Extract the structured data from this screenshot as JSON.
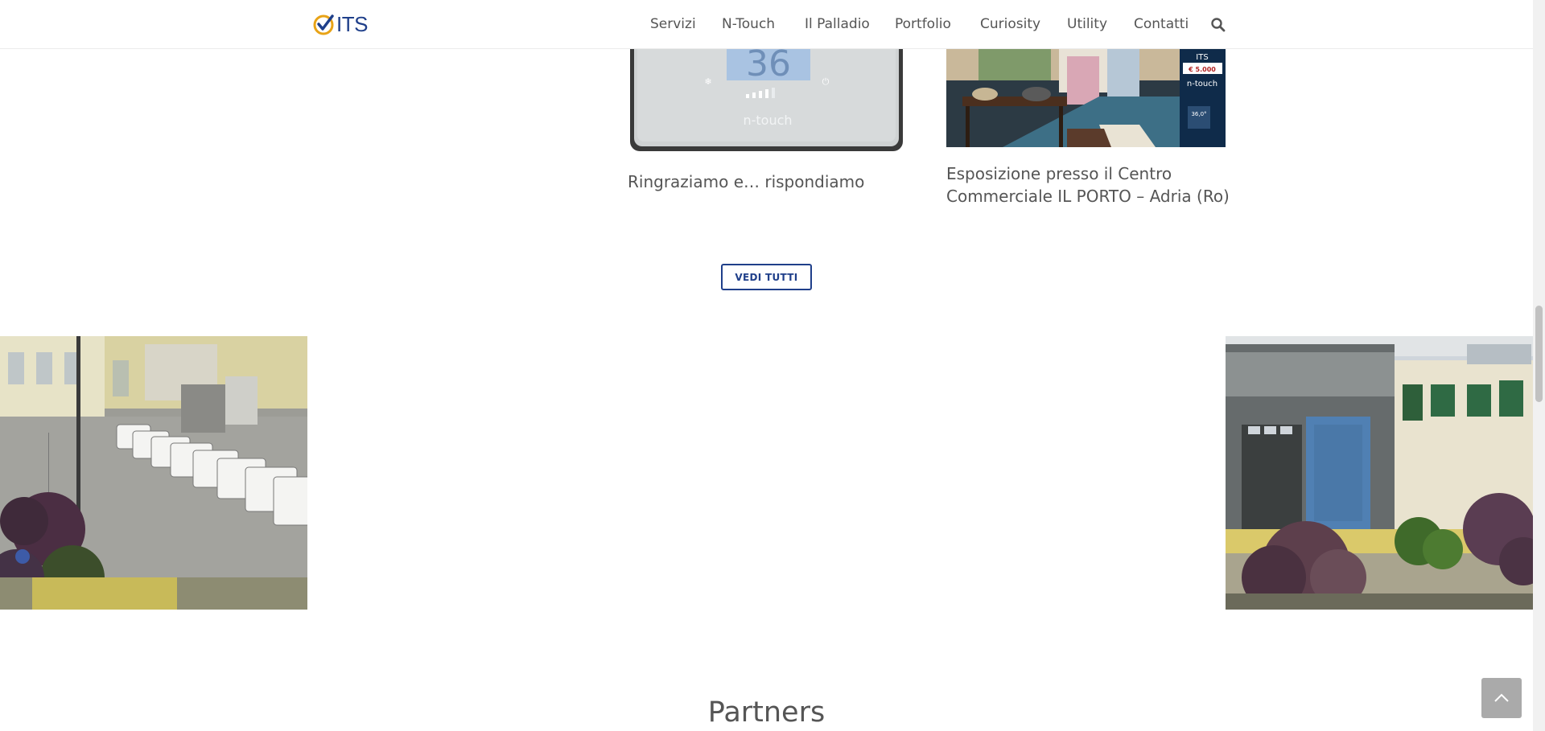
{
  "header": {
    "logo_text": "ITS",
    "nav": [
      "Servizi",
      "N-Touch",
      "Il Palladio",
      "Portfolio",
      "Curiosity",
      "Utility",
      "Contatti"
    ]
  },
  "posts": [
    {
      "title": "Ringraziamo e… rispondiamo",
      "image_text": {
        "temperature": "36",
        "brand": "n-touch"
      }
    },
    {
      "title_line1": "Esposizione presso il Centro",
      "title_line2": "Commerciale IL PORTO – Adria (Ro)",
      "image_text": {
        "sign_brand": "n-touch",
        "sign_temp": "36,0°",
        "sign_price": "€ 5.000",
        "sign_its": "ITS"
      }
    }
  ],
  "buttons": {
    "vedi_tutti": "VEDI TUTTI"
  },
  "sections": {
    "partners_title": "Partners"
  },
  "colors": {
    "brand_blue": "#1f3f8a",
    "logo_accent": "#e8a317",
    "button_gray": "#aaaaaa"
  }
}
